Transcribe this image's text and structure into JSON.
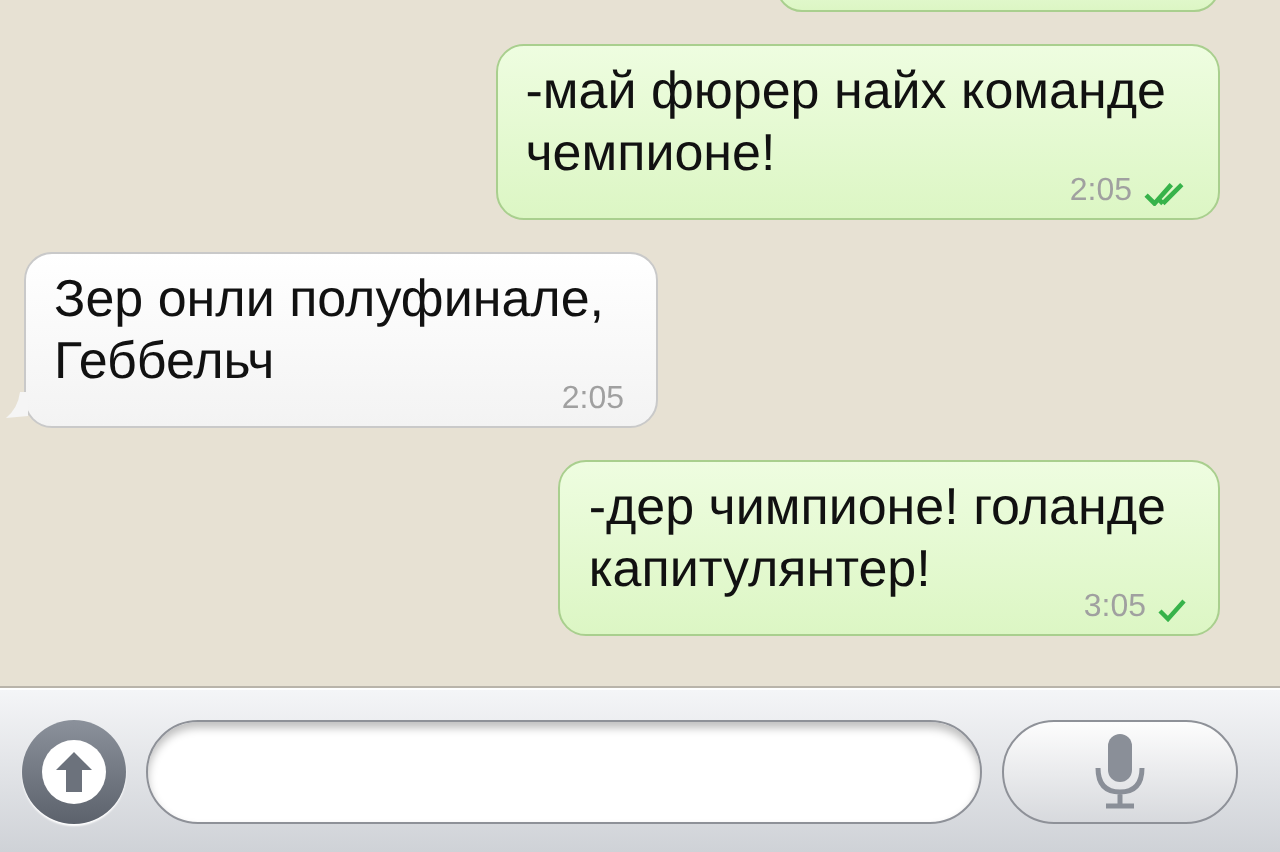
{
  "messages": [
    {
      "kind": "cut",
      "outgoing": true
    },
    {
      "kind": "text",
      "outgoing": true,
      "text": "-май фюрер найх команде\nчемпионе!",
      "time": "2:05",
      "read": true
    },
    {
      "kind": "text",
      "outgoing": false,
      "text": "Зер онли полуфинале,\nГеббельч",
      "time": "2:05"
    },
    {
      "kind": "text",
      "outgoing": true,
      "text": "-дер чимпионе! голанде\nкапитулянтер!",
      "time": "3:05",
      "read": false
    }
  ],
  "composer": {
    "attach": true,
    "voice": true
  }
}
